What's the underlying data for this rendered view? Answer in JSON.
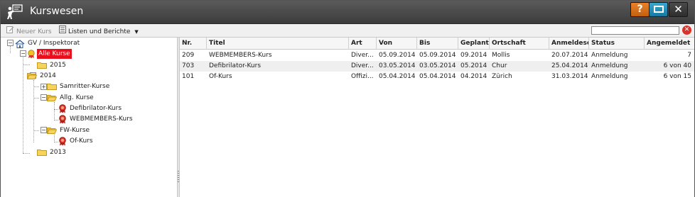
{
  "window": {
    "title": "Kurswesen",
    "help_label": "?",
    "close_label": "✕"
  },
  "toolbar": {
    "new_course_label": "Neuer Kurs",
    "lists_label": "Listen und Berichte",
    "search_value": "",
    "search_placeholder": ""
  },
  "tree": {
    "root": "GV / Inspektorat",
    "all_courses": "Alle Kurse",
    "y2015": "2015",
    "y2014": "2014",
    "samariter": "Samritter-Kurse",
    "allg": "Allg. Kurse",
    "defib": "Defibrilator-Kurs",
    "webmembers": "WEBMEMBERS-Kurs",
    "fw": "FW-Kurse",
    "of": "Of-Kurs",
    "y2013": "2013"
  },
  "grid": {
    "columns": [
      "Nr.",
      "Titel",
      "Art",
      "Von",
      "Bis",
      "Geplant",
      "Ortschaft",
      "Anmeldesc",
      "Status",
      "Angemeldet"
    ],
    "rows": [
      [
        "209",
        "WEBMEMBERS-Kurs",
        "Diver...",
        "05.09.2014",
        "05.09.2014",
        "09.2014",
        "Mollis",
        "20.07.2014",
        "Anmeldung",
        "7"
      ],
      [
        "703",
        "Defibrilator-Kurs",
        "Diver...",
        "03.05.2014",
        "03.05.2014",
        "05.2014",
        "Chur",
        "25.04.2014",
        "Anmeldung",
        "6 von 40"
      ],
      [
        "101",
        "Of-Kurs",
        "Offizi...",
        "05.04.2014",
        "05.04.2014",
        "04.2014",
        "Zürich",
        "31.03.2014",
        "Anmeldung",
        "6 von 15"
      ]
    ]
  },
  "colors": {
    "titlebar": "#4a4a4a",
    "help_button": "#e07a26",
    "maximize_button": "#2792bd",
    "selection": "#e8101c",
    "alt_row": "#efefef"
  }
}
